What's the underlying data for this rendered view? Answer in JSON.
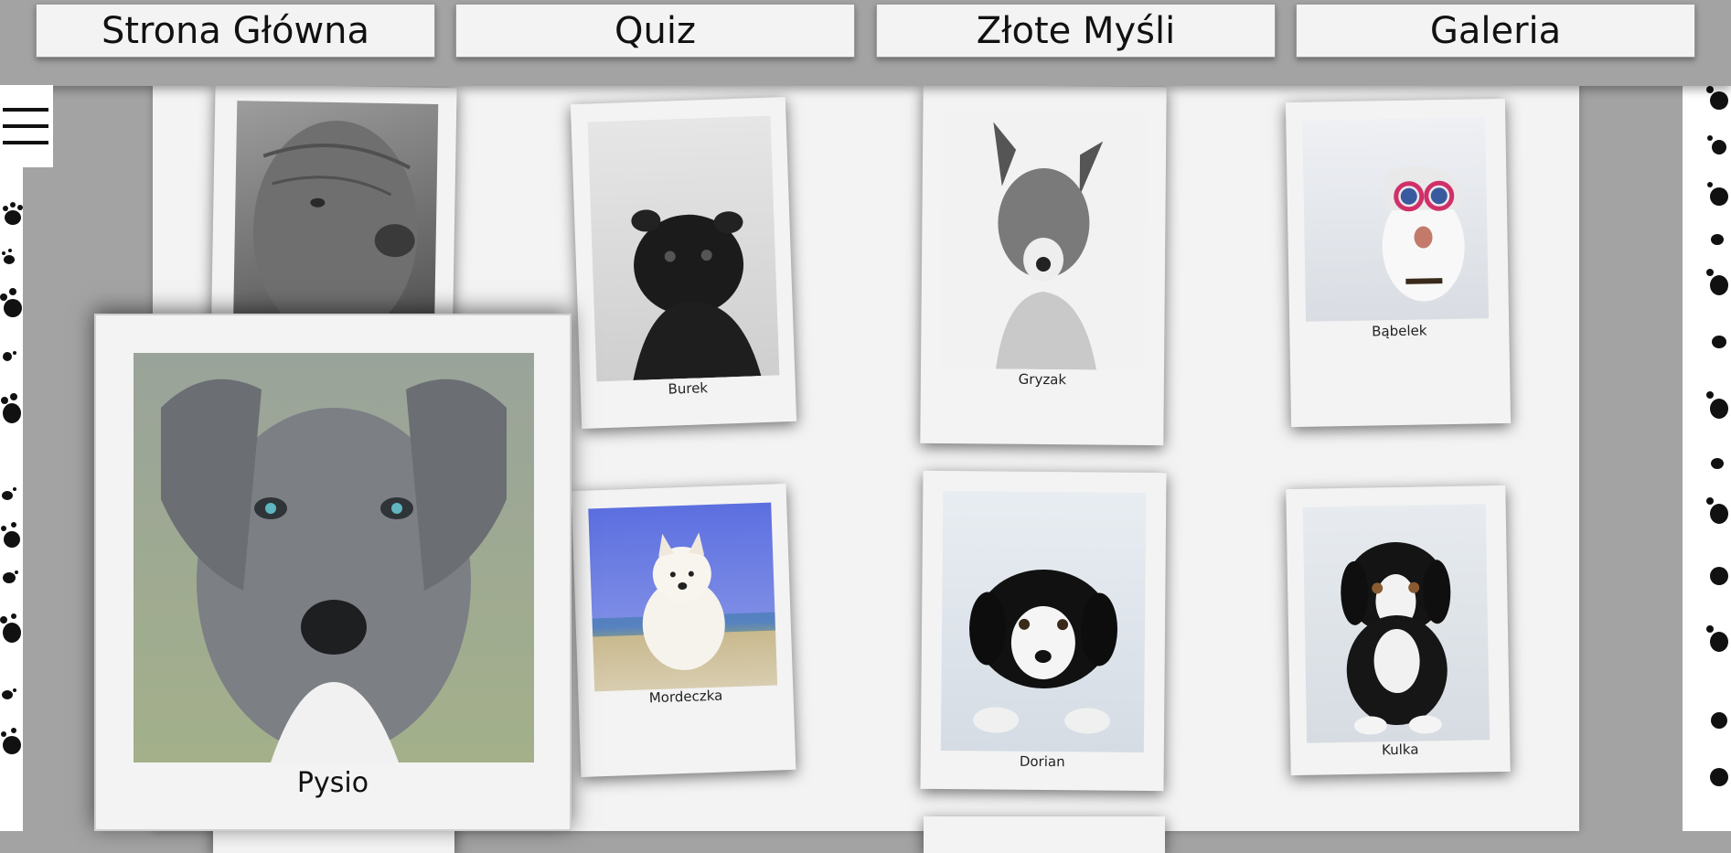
{
  "nav": {
    "items": [
      {
        "label": "Strona Główna"
      },
      {
        "label": "Quiz"
      },
      {
        "label": "Złote Myśli"
      },
      {
        "label": "Galeria"
      }
    ]
  },
  "gallery": {
    "cards": [
      {
        "name": "Burek"
      },
      {
        "name": "Gryzak"
      },
      {
        "name": "Bąbelek"
      },
      {
        "name": "Mordeczka"
      },
      {
        "name": "Dorian"
      },
      {
        "name": "Kulka"
      }
    ],
    "selected": {
      "name": "Pysio"
    }
  },
  "icons": {
    "menu": "hamburger-icon",
    "paw": "paw-print-icon"
  },
  "colors": {
    "background": "#a3a3a3",
    "panel": "#f3f3f3",
    "paw": "#111111"
  }
}
